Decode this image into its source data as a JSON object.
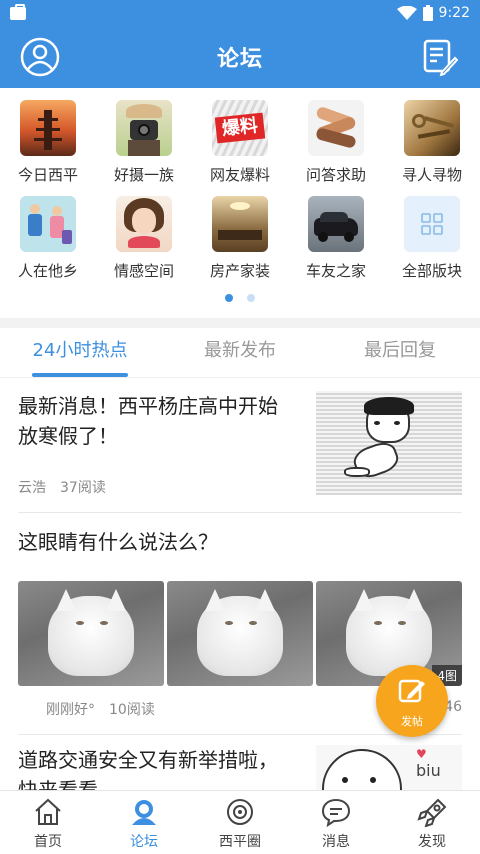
{
  "status_bar": {
    "time": "9:22"
  },
  "header": {
    "title": "论坛",
    "left_icon": "user-avatar-icon",
    "right_icon": "compose-note-icon"
  },
  "categories": [
    {
      "label": "今日西平",
      "icon": "pagoda-photo"
    },
    {
      "label": "好摄一族",
      "icon": "camera-photo"
    },
    {
      "label": "网友爆料",
      "icon": "baoliao-badge",
      "badge_text": "爆料"
    },
    {
      "label": "问答求助",
      "icon": "hands-photo"
    },
    {
      "label": "寻人寻物",
      "icon": "keys-photo"
    },
    {
      "label": "人在他乡",
      "icon": "travelers-illustration"
    },
    {
      "label": "情感空间",
      "icon": "girl-photo"
    },
    {
      "label": "房产家装",
      "icon": "interior-photo"
    },
    {
      "label": "车友之家",
      "icon": "car-photo"
    },
    {
      "label": "全部版块",
      "icon": "grid-icon"
    }
  ],
  "pager": {
    "pages": 2,
    "active": 0
  },
  "tabs": [
    {
      "label": "24小时热点",
      "active": true
    },
    {
      "label": "最新发布",
      "active": false
    },
    {
      "label": "最后回复",
      "active": false
    }
  ],
  "posts": [
    {
      "title": "最新消息！西平杨庄高中开始放寒假了！",
      "author": "云浩",
      "reads": "37阅读"
    },
    {
      "title": "这眼睛有什么说法么？",
      "author": "刚刚好°",
      "reads": "10阅读",
      "image_count": "4图",
      "trailing": "46"
    },
    {
      "title": "道路交通安全又有新举措啦，快来看看",
      "sticker_text": "biu"
    }
  ],
  "fab": {
    "label": "发帖"
  },
  "bottom_nav": [
    {
      "label": "首页",
      "icon": "home-icon",
      "active": false
    },
    {
      "label": "论坛",
      "icon": "forum-icon",
      "active": true
    },
    {
      "label": "西平圈",
      "icon": "circle-icon",
      "active": false
    },
    {
      "label": "消息",
      "icon": "message-icon",
      "active": false
    },
    {
      "label": "发现",
      "icon": "discover-icon",
      "active": false
    }
  ],
  "colors": {
    "primary": "#3d8fe0",
    "fab": "#f7a51c",
    "text": "#222222",
    "muted": "#888888"
  }
}
